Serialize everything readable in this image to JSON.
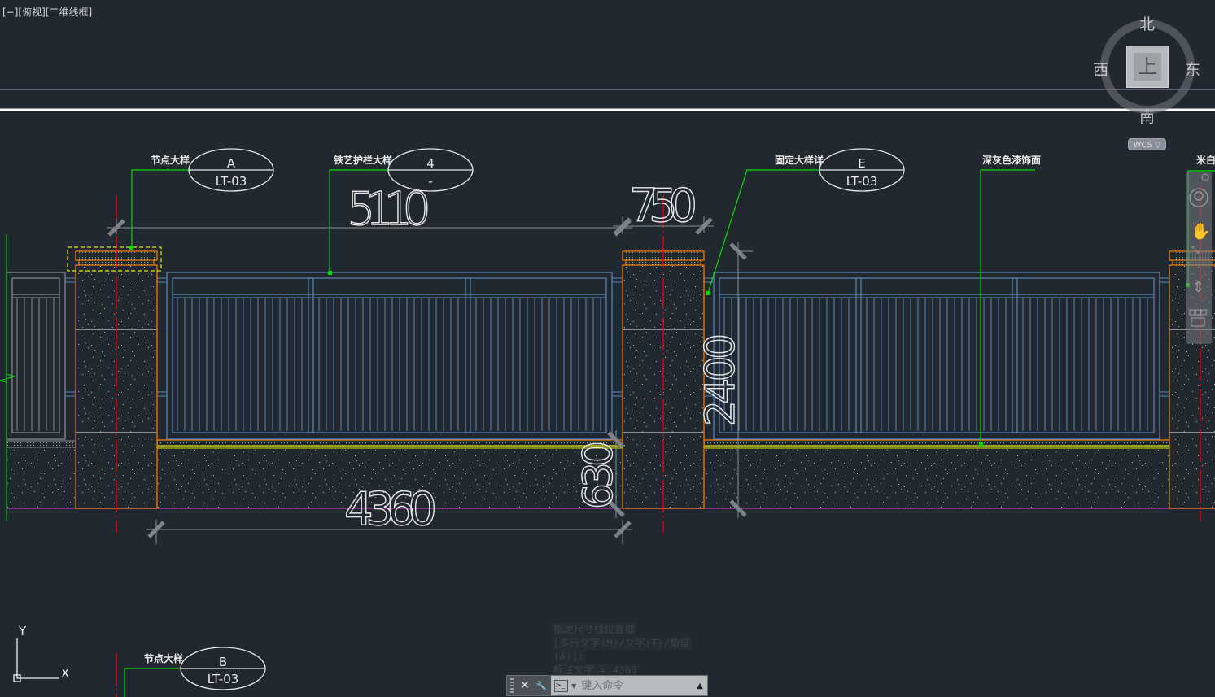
{
  "viewport": {
    "label": "[−][俯视][二维线框]"
  },
  "viewcube": {
    "north": "北",
    "south": "南",
    "east": "东",
    "west": "西",
    "face": "上",
    "wcs_label": "WCS ▽"
  },
  "dimensions": {
    "d5110": "5110",
    "d750": "750",
    "d4360": "4360",
    "d630": "630",
    "d2400": "2400"
  },
  "callouts": [
    {
      "caption": "节点大样",
      "top": "A",
      "bottom": "LT-03"
    },
    {
      "caption": "铁艺护栏大样",
      "top": "4",
      "bottom": "-"
    },
    {
      "caption": "固定大样详",
      "top": "E",
      "bottom": "LT-03"
    },
    {
      "caption": "节点大样",
      "top": "B",
      "bottom": "LT-03"
    }
  ],
  "notes": {
    "dark_grey_paint": "深灰色漆饰面",
    "off_white": "米白色"
  },
  "ucs": {
    "x": "X",
    "y": "Y"
  },
  "command": {
    "history": [
      "指定尺寸线位置或",
      "[多行文字(M)/文字(T)/角度",
      "(A)]:",
      "标注文字 = 4360"
    ],
    "placeholder": "键入命令",
    "close_icon": "✕",
    "settings_icon": "🔧"
  },
  "colors": {
    "background": "#212830",
    "pillar": "#ff7f00",
    "fence": "#5b86b8",
    "leader": "#00e000",
    "centerline": "#ff0000",
    "ground": "#d020d0",
    "base_line": "#e6e600",
    "dimension": "#8a8f95"
  }
}
